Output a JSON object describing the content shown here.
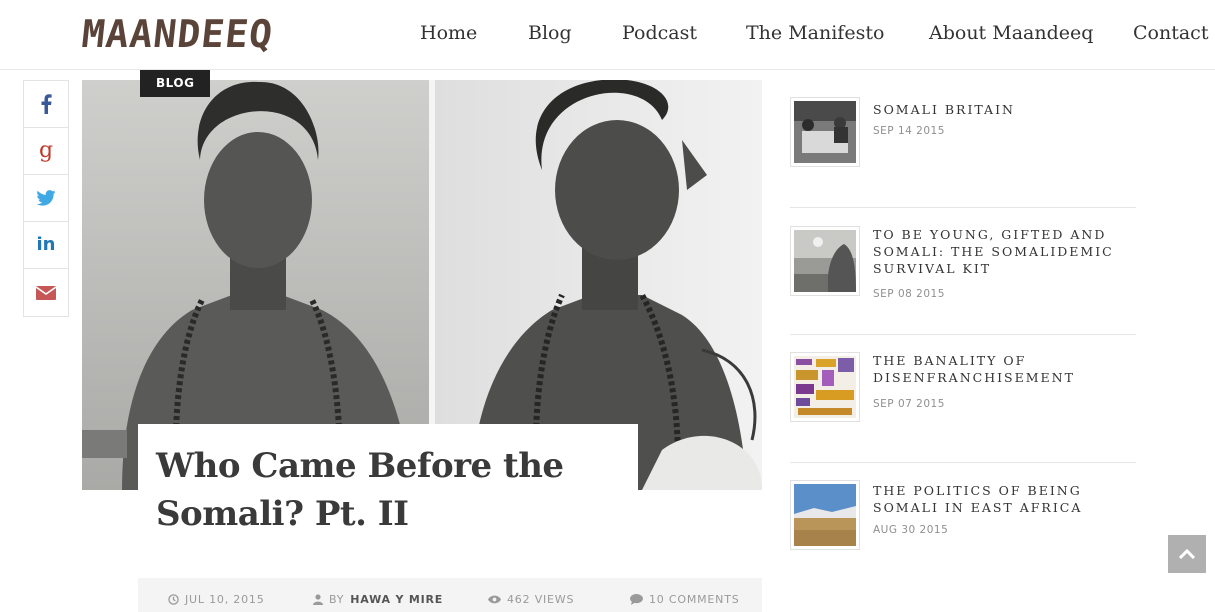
{
  "site": {
    "logo": "MAANDEEQ",
    "nav": [
      {
        "label": "Home"
      },
      {
        "label": "Blog"
      },
      {
        "label": "Podcast"
      },
      {
        "label": "The Manifesto"
      },
      {
        "label": "About Maandeeq"
      },
      {
        "label": "Contact"
      }
    ]
  },
  "share": [
    {
      "icon": "facebook-icon",
      "color": "#3b5998"
    },
    {
      "icon": "google-plus-icon",
      "color": "#c0392b"
    },
    {
      "icon": "twitter-icon",
      "color": "#3fa9e4"
    },
    {
      "icon": "linkedin-icon",
      "color": "#1f77b4"
    },
    {
      "icon": "email-icon",
      "color": "#c75757"
    }
  ],
  "post": {
    "category": "BLOG",
    "title_line1": "Who Came Before the",
    "title_line2": "Somali? Pt. II",
    "meta": {
      "date": "JUL 10, 2015",
      "by_prefix": "BY",
      "author": "HAWA Y MIRE",
      "views": "462 VIEWS",
      "comments": "10 COMMENTS"
    }
  },
  "sidebar": {
    "posts": [
      {
        "title": "SOMALI BRITAIN",
        "date": "SEP 14 2015"
      },
      {
        "title": "TO BE YOUNG, GIFTED AND SOMALI: THE SOMALIDEMIC SURVIVAL KIT",
        "date": "SEP 08 2015"
      },
      {
        "title": "THE BANALITY OF DISENFRANCHISEMENT",
        "date": "SEP 07 2015"
      },
      {
        "title": "THE POLITICS OF BEING SOMALI IN EAST AFRICA",
        "date": "AUG 30 2015"
      }
    ]
  },
  "colors": {
    "logo": "#5a4338",
    "badge_bg": "#222222",
    "meta_bg": "#f4f4f4",
    "to_top_bg": "#b0b0b0"
  }
}
